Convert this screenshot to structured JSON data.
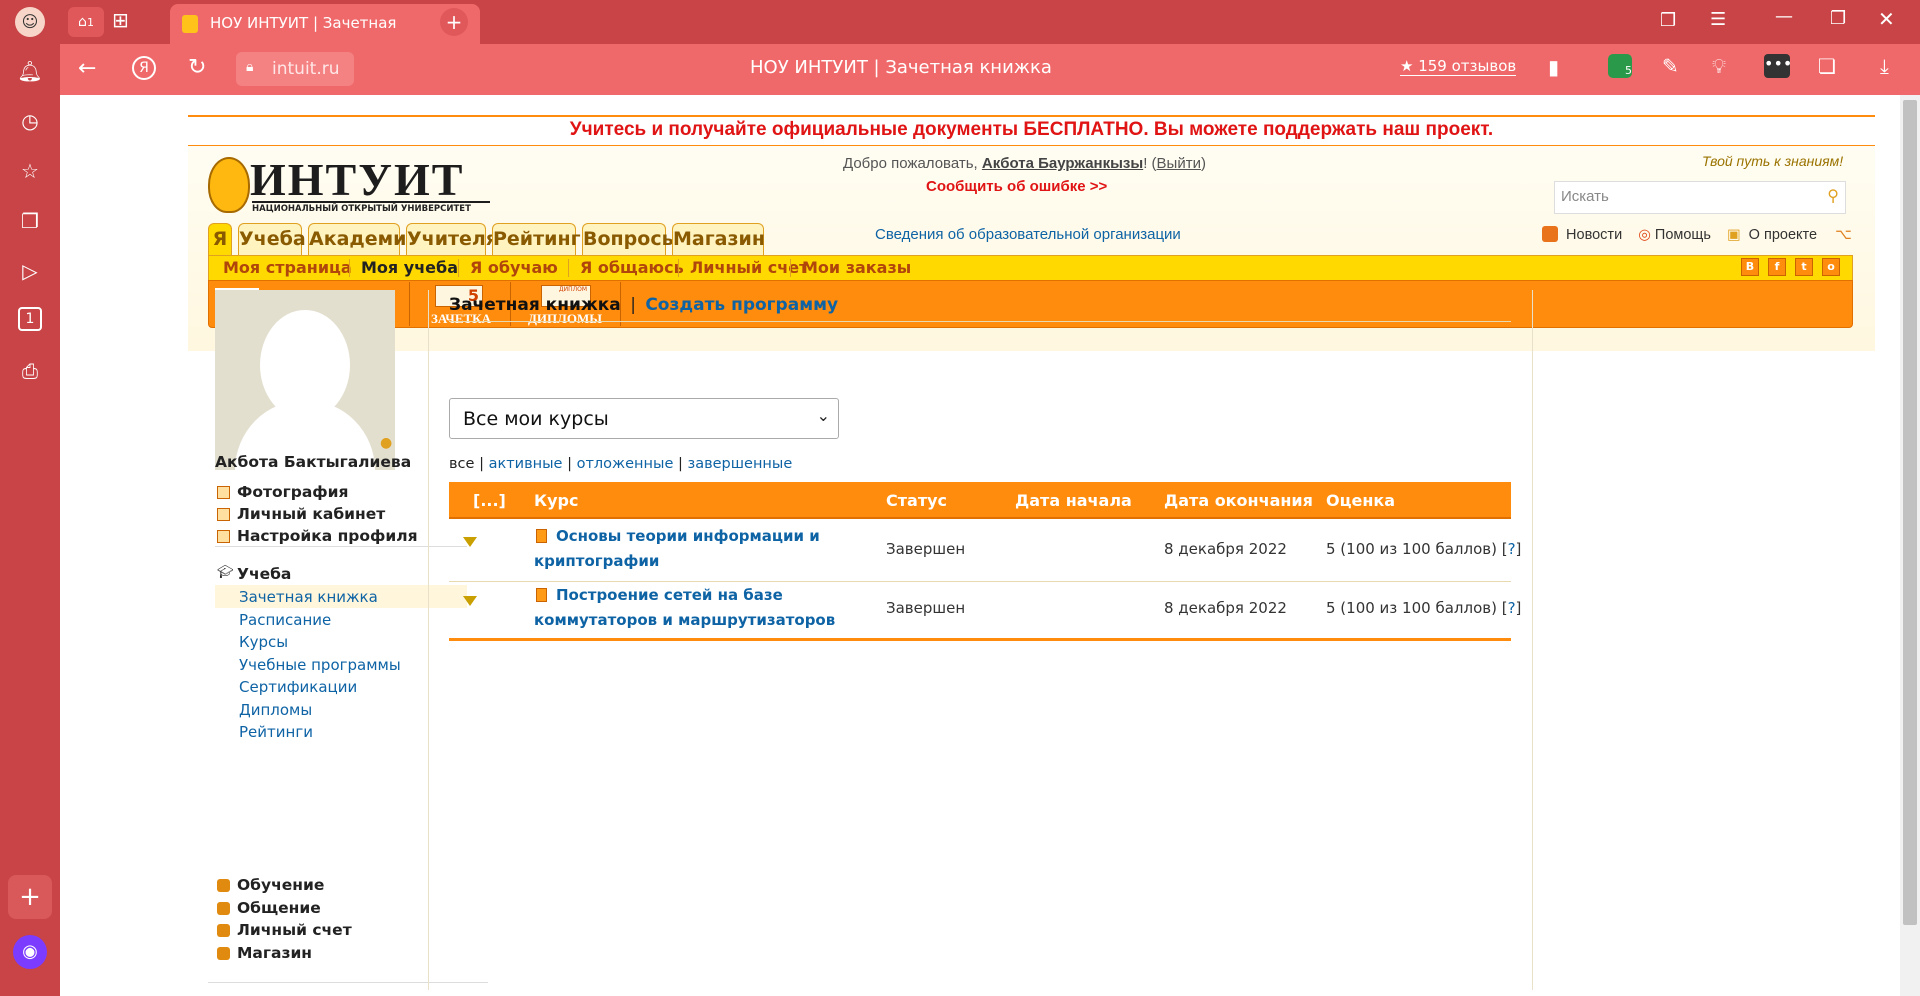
{
  "browser": {
    "tab_badge": "1",
    "tab_title": "НОУ ИНТУИТ | Зачетная",
    "address": "intuit.ru",
    "page_title": "НОУ ИНТУИТ | Зачетная книжка",
    "reviews": "★ 159 отзывов",
    "ext_badge": "5",
    "sidebar_badge": "1"
  },
  "banner": "Учитесь и получайте официальные документы БЕСПЛАТНО. Вы можете поддержать наш проект.",
  "header": {
    "logo_text": "ИНТУИТ",
    "logo_sub": "НАЦИОНАЛЬНЫЙ ОТКРЫТЫЙ УНИВЕРСИТЕТ",
    "welcome_prefix": "Добро пожаловать, ",
    "user_link": "Акбота Бауржанкызы",
    "exclaim": "! (",
    "logout": "Выйти",
    "close_paren": ")",
    "report_error": "Сообщить об ошибке >>",
    "slogan": "Твой путь к знаниям!",
    "search_placeholder": "Искать",
    "org_info": "Сведения об образовательной организации",
    "news": "Новости",
    "help": "Помощь",
    "about": "О проекте"
  },
  "nav_tabs": [
    "Я",
    "Учеба",
    "Академии",
    "Учителя",
    "Рейтинг",
    "Вопросы",
    "Магазин"
  ],
  "sub_nav": [
    "Моя страница",
    "Моя учеба",
    "Я обучаю",
    "Я общаюсь",
    "Личный счет",
    "Мои заказы"
  ],
  "social": [
    "В",
    "f",
    "t",
    "о"
  ],
  "icons_bar": {
    "zachetka": "ЗАЧЕТКА",
    "diplomy": "ДИПЛОМЫ",
    "grade_digit": "5",
    "diploma_word": "ДИПЛОМ"
  },
  "sidebar": {
    "user_name": "Акбота Бактыгалиева",
    "profile_links": [
      "Фотография",
      "Личный кабинет",
      "Настройка профиля"
    ],
    "study_heading": "Учеба",
    "study_links": [
      "Зачетная книжка",
      "Расписание",
      "Курсы",
      "Учебные программы",
      "Сертификации",
      "Дипломы",
      "Рейтинги"
    ],
    "other_sections": [
      "Обучение",
      "Общение",
      "Личный счет",
      "Магазин"
    ]
  },
  "main": {
    "title": "Зачетная книжка",
    "separator": "|",
    "create_program": "Создать программу",
    "select_value": "Все мои курсы",
    "filter": {
      "all": "все",
      "active": "активные",
      "postponed": "отложенные",
      "completed": "завершенные",
      "sep": "|"
    },
    "table": {
      "headers": [
        "[...]",
        "Курс",
        "Статус",
        "Дата начала",
        "Дата окончания",
        "Оценка"
      ],
      "rows": [
        {
          "course_line1": "Основы теории информации и",
          "course_line2": "криптографии",
          "status": "Завершен",
          "start": "",
          "end": "8 декабря 2022",
          "grade": "5 (100 из 100 баллов) [",
          "help": "?",
          "grade_end": "]"
        },
        {
          "course_line1": "Построение сетей на базе",
          "course_line2": "коммутаторов и маршрутизаторов",
          "status": "Завершен",
          "start": "",
          "end": "8 декабря 2022",
          "grade": "5 (100 из 100 баллов) [",
          "help": "?",
          "grade_end": "]"
        }
      ]
    }
  },
  "colors": {
    "chrome": "#c84446",
    "addr": "#f0696a",
    "orange": "#ff8c0c",
    "yellow": "#ffd900",
    "link": "#0e63a5",
    "banner_red": "#e01414"
  }
}
